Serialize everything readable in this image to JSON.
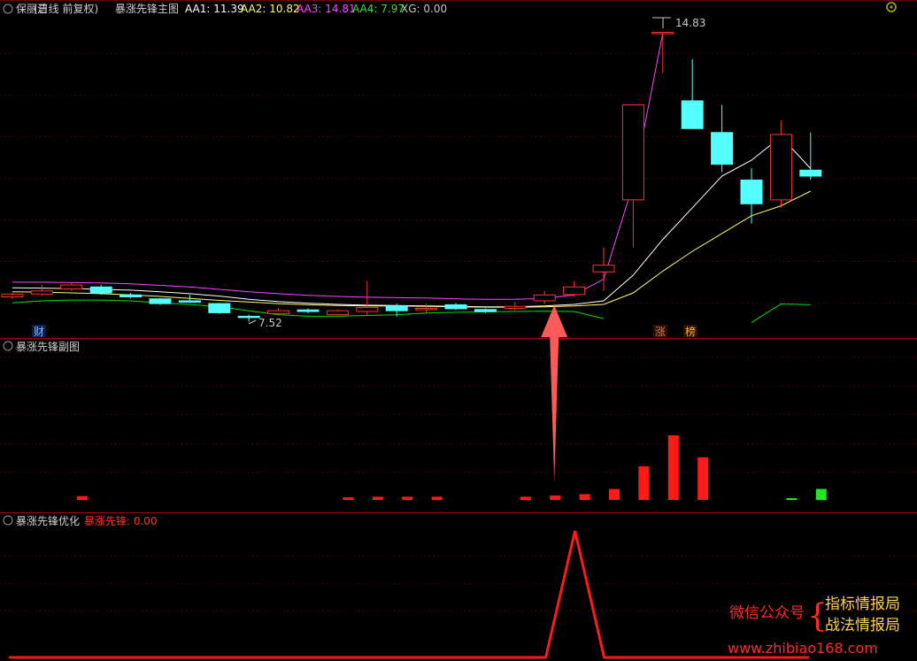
{
  "colors": {
    "background": "#000000",
    "up_candle": "#ff3232",
    "down_candle": "#54ffff",
    "aa1": "#ffffff",
    "aa2": "#ffff66",
    "aa3": "#ff44ff",
    "aa4": "#00e000",
    "separator": "#b40000",
    "grid": "#7a0000",
    "signal_line": "#ff1a1a",
    "arrow": "#ff5a5a"
  },
  "main_panel": {
    "stock_name": "保丽洁",
    "period": "(日线 前复权)",
    "indicator_name": "暴涨先锋主图",
    "aa1_label": "AA1: 11.39",
    "aa2_label": "AA2: 10.82",
    "aa3_label": "AA3: 14.81",
    "aa4_label": "AA4: 7.97",
    "xg_label": "XG: 0.00",
    "high_label": "14.83",
    "low_label": "7.52",
    "badge_cai": "财",
    "badge_zhang": "涨",
    "badge_bang": "榜"
  },
  "sub_panel": {
    "title": "暴涨先锋副图"
  },
  "opt_panel": {
    "title": "暴涨先锋优化",
    "signal_label": "暴涨先锋: 0.00"
  },
  "watermark": {
    "wechat": "微信公众号",
    "brace": "{",
    "line1": "指标情报局",
    "line2": "战法情报局",
    "url": "www.zhibiao168.com"
  },
  "chart_data": {
    "type": "candlestick",
    "price_ylim": [
      7.2,
      15.2
    ],
    "candles": [
      {
        "o": 8.15,
        "c": 8.22,
        "h": 8.25,
        "l": 8.1
      },
      {
        "o": 8.22,
        "c": 8.3,
        "h": 8.45,
        "l": 8.18
      },
      {
        "o": 8.35,
        "c": 8.45,
        "h": 8.52,
        "l": 8.3
      },
      {
        "o": 8.4,
        "c": 8.25,
        "h": 8.45,
        "l": 8.2
      },
      {
        "o": 8.2,
        "c": 8.15,
        "h": 8.25,
        "l": 8.12
      },
      {
        "o": 8.1,
        "c": 7.98,
        "h": 8.12,
        "l": 7.95
      },
      {
        "o": 8.05,
        "c": 8.03,
        "h": 8.2,
        "l": 8.0
      },
      {
        "o": 7.98,
        "c": 7.75,
        "h": 8.0,
        "l": 7.72
      },
      {
        "o": 7.66,
        "c": 7.64,
        "h": 7.7,
        "l": 7.52
      },
      {
        "o": 7.73,
        "c": 7.8,
        "h": 7.87,
        "l": 7.68
      },
      {
        "o": 7.82,
        "c": 7.78,
        "h": 7.86,
        "l": 7.74
      },
      {
        "o": 7.7,
        "c": 7.8,
        "h": 7.83,
        "l": 7.68
      },
      {
        "o": 7.78,
        "c": 7.88,
        "h": 8.55,
        "l": 7.7
      },
      {
        "o": 7.92,
        "c": 7.8,
        "h": 7.98,
        "l": 7.65
      },
      {
        "o": 7.85,
        "c": 7.86,
        "h": 7.98,
        "l": 7.75
      },
      {
        "o": 7.95,
        "c": 7.85,
        "h": 7.99,
        "l": 7.82
      },
      {
        "o": 7.83,
        "c": 7.78,
        "h": 7.86,
        "l": 7.74
      },
      {
        "o": 7.86,
        "c": 7.91,
        "h": 8.02,
        "l": 7.8
      },
      {
        "o": 8.05,
        "c": 8.2,
        "h": 8.3,
        "l": 7.97
      },
      {
        "o": 8.21,
        "c": 8.4,
        "h": 8.55,
        "l": 8.15
      },
      {
        "o": 8.78,
        "c": 8.95,
        "h": 9.4,
        "l": 8.3
      },
      {
        "o": 10.6,
        "c": 13.0,
        "h": 13.0,
        "l": 9.4
      },
      {
        "o": 14.83,
        "c": 14.83,
        "h": 14.83,
        "l": 13.8
      },
      {
        "o": 13.1,
        "c": 12.4,
        "h": 14.15,
        "l": 12.4
      },
      {
        "o": 12.3,
        "c": 11.5,
        "h": 13.0,
        "l": 11.3
      },
      {
        "o": 11.1,
        "c": 10.5,
        "h": 11.4,
        "l": 10.0
      },
      {
        "o": 10.6,
        "c": 12.25,
        "h": 12.6,
        "l": 10.4
      },
      {
        "o": 11.35,
        "c": 11.2,
        "h": 12.3,
        "l": 11.1
      }
    ],
    "aa1": [
      8.38,
      8.37,
      8.36,
      8.34,
      8.32,
      8.28,
      8.23,
      8.17,
      8.09,
      8.03,
      7.99,
      7.96,
      7.94,
      7.93,
      7.92,
      7.91,
      7.9,
      7.9,
      7.92,
      7.96,
      8.05,
      8.7,
      9.6,
      10.4,
      11.2,
      11.6,
      12.2,
      11.39
    ],
    "aa2": [
      8.28,
      8.27,
      8.25,
      8.23,
      8.2,
      8.16,
      8.11,
      8.06,
      8.02,
      7.98,
      7.95,
      7.93,
      7.92,
      7.92,
      7.91,
      7.9,
      7.89,
      7.89,
      7.9,
      7.92,
      7.96,
      8.25,
      8.8,
      9.3,
      9.75,
      10.2,
      10.45,
      10.82
    ],
    "aa3": [
      8.52,
      8.52,
      8.51,
      8.5,
      8.48,
      8.44,
      8.4,
      8.34,
      8.28,
      8.23,
      8.19,
      8.16,
      8.14,
      8.13,
      8.12,
      8.1,
      8.09,
      8.09,
      8.11,
      8.2,
      8.6,
      11.0,
      14.81,
      null,
      null,
      null,
      null,
      null
    ],
    "aa4": [
      8.0,
      8.05,
      8.07,
      8.07,
      8.05,
      8.0,
      7.96,
      7.9,
      7.8,
      7.7,
      7.66,
      7.66,
      7.68,
      7.7,
      7.74,
      7.76,
      7.77,
      7.78,
      7.79,
      7.78,
      7.6,
      null,
      null,
      null,
      null,
      7.5,
      7.97,
      7.95
    ],
    "sub_max": 1.0,
    "sub_bars": [
      {
        "i": 2,
        "v": 0.06,
        "color": "red"
      },
      {
        "i": 11,
        "v": 0.03,
        "color": "red"
      },
      {
        "i": 12,
        "v": 0.05,
        "color": "red"
      },
      {
        "i": 13,
        "v": 0.05,
        "color": "red"
      },
      {
        "i": 14,
        "v": 0.05,
        "color": "red"
      },
      {
        "i": 17,
        "v": 0.05,
        "color": "red"
      },
      {
        "i": 18,
        "v": 0.07,
        "color": "red"
      },
      {
        "i": 19,
        "v": 0.09,
        "color": "red"
      },
      {
        "i": 20,
        "v": 0.17,
        "color": "red"
      },
      {
        "i": 21,
        "v": 0.52,
        "color": "red"
      },
      {
        "i": 22,
        "v": 1.0,
        "color": "red"
      },
      {
        "i": 23,
        "v": 0.66,
        "color": "red"
      },
      {
        "i": 26,
        "v": 0.02,
        "color": "green"
      },
      {
        "i": 27,
        "v": 0.17,
        "color": "green"
      }
    ],
    "signal": [
      0,
      0,
      0,
      0,
      0,
      0,
      0,
      0,
      0,
      0,
      0,
      0,
      0,
      0,
      0,
      0,
      0,
      0,
      0,
      1,
      0,
      0,
      0,
      0,
      0,
      0,
      0,
      0
    ],
    "signal_max": 1.0,
    "arrow_index": 18
  }
}
